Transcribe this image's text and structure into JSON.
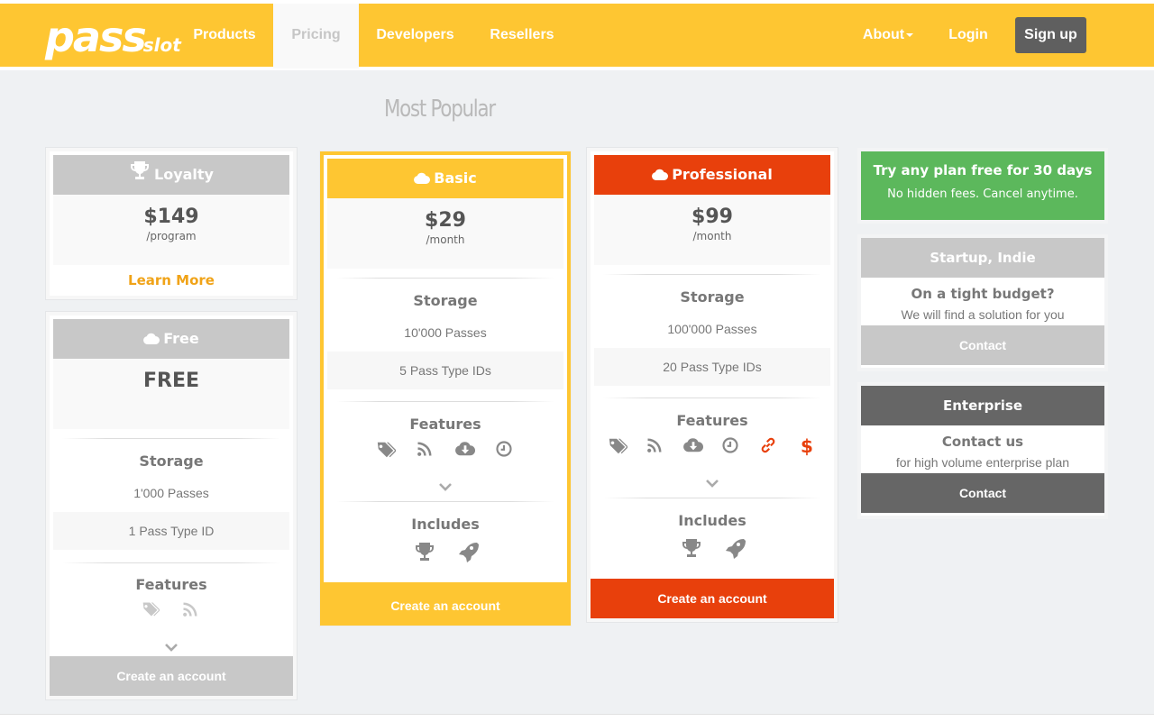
{
  "colors": {
    "brand": "#fec632",
    "red": "#e8400c",
    "grey": "#c8c8c8",
    "dark": "#666666",
    "green": "#5cb85c",
    "orange": "#f0a318"
  },
  "nav": {
    "logo_main": "pass",
    "logo_sub": "slot",
    "items": [
      "Products",
      "Pricing",
      "Developers",
      "Resellers"
    ],
    "active": "Pricing",
    "about": "About",
    "login": "Login",
    "signup": "Sign up"
  },
  "most_popular": "Most Popular",
  "loyalty": {
    "title": "Loyalty",
    "icon": "trophy-icon",
    "price": "$149",
    "per": "/program",
    "link": "Learn More"
  },
  "free": {
    "title": "Free",
    "icon": "cloud-icon",
    "price": "FREE",
    "storage_title": "Storage",
    "passes": "1'000 Passes",
    "type_ids": "1 Pass Type ID",
    "features_title": "Features",
    "features": [
      "tags-icon",
      "rss-icon"
    ],
    "cta": "Create an account"
  },
  "basic": {
    "title": "Basic",
    "icon": "cloud-icon",
    "price": "$29",
    "per": "/month",
    "storage_title": "Storage",
    "passes": "10'000 Passes",
    "type_ids": "5 Pass Type IDs",
    "features_title": "Features",
    "features": [
      "tags-icon",
      "rss-icon",
      "cloud-download-icon",
      "clock-icon"
    ],
    "includes_title": "Includes",
    "includes": [
      "trophy-icon",
      "rocket-icon"
    ],
    "cta": "Create an account"
  },
  "professional": {
    "title": "Professional",
    "icon": "cloud-icon",
    "price": "$99",
    "per": "/month",
    "storage_title": "Storage",
    "passes": "100'000 Passes",
    "type_ids": "20 Pass Type IDs",
    "features_title": "Features",
    "features": [
      "tags-icon",
      "rss-icon",
      "cloud-download-icon",
      "clock-icon",
      "link-icon",
      "dollar-icon"
    ],
    "includes_title": "Includes",
    "includes": [
      "trophy-icon",
      "rocket-icon"
    ],
    "cta": "Create an account"
  },
  "trial": {
    "title": "Try any plan free for 30 days",
    "sub": "No hidden fees. Cancel anytime."
  },
  "startup": {
    "title": "Startup, Indie",
    "question": "On a tight budget?",
    "sub": "We will find a solution for you",
    "cta": "Contact"
  },
  "enterprise": {
    "title": "Enterprise",
    "question": "Contact us",
    "sub": "for high volume enterprise plan",
    "cta": "Contact"
  }
}
